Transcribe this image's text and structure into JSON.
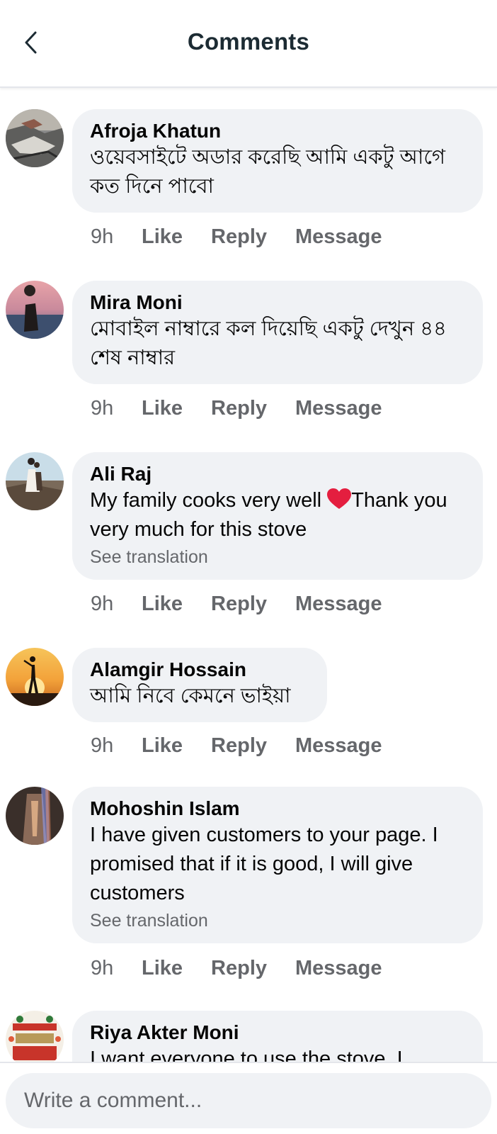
{
  "header": {
    "title": "Comments",
    "back_icon": "chevron-left-icon"
  },
  "comments": [
    {
      "name": "Afroja Khatun",
      "text": "ওয়েবসাইটে অডার করেছি আমি একটু আগে কত দিনে পাবো",
      "translation": "",
      "time": "9h",
      "like": "Like",
      "reply": "Reply",
      "message": "Message"
    },
    {
      "name": "Mira Moni",
      "text": "মোবাইল নাম্বারে কল দিয়েছি একটু দেখুন ৪৪ শেষ নাম্বার",
      "translation": "",
      "time": "9h",
      "like": "Like",
      "reply": "Reply",
      "message": "Message"
    },
    {
      "name": "Ali Raj",
      "text_before": "My family cooks very well",
      "text_after": "Thank you very much for this stove",
      "translation": "See translation",
      "time": "9h",
      "like": "Like",
      "reply": "Reply",
      "message": "Message"
    },
    {
      "name": "Alamgir Hossain",
      "text": "আমি নিবে কেমনে ভাইয়া",
      "translation": "",
      "time": "9h",
      "like": "Like",
      "reply": "Reply",
      "message": "Message"
    },
    {
      "name": "Mohoshin Islam",
      "text": "I have given customers to your page. I promised that if it is good, I will give customers",
      "translation": "See translation",
      "time": "9h",
      "like": "Like",
      "reply": "Reply",
      "message": "Message"
    },
    {
      "name": "Riya Akter Moni",
      "text": "I want everyone to use the stove. I",
      "translation": "",
      "time": "",
      "like": "",
      "reply": "",
      "message": ""
    }
  ],
  "composer": {
    "placeholder": "Write a comment..."
  },
  "colors": {
    "bubble": "#f0f2f5",
    "meta": "#65676b",
    "heart": "#e41e3f"
  }
}
